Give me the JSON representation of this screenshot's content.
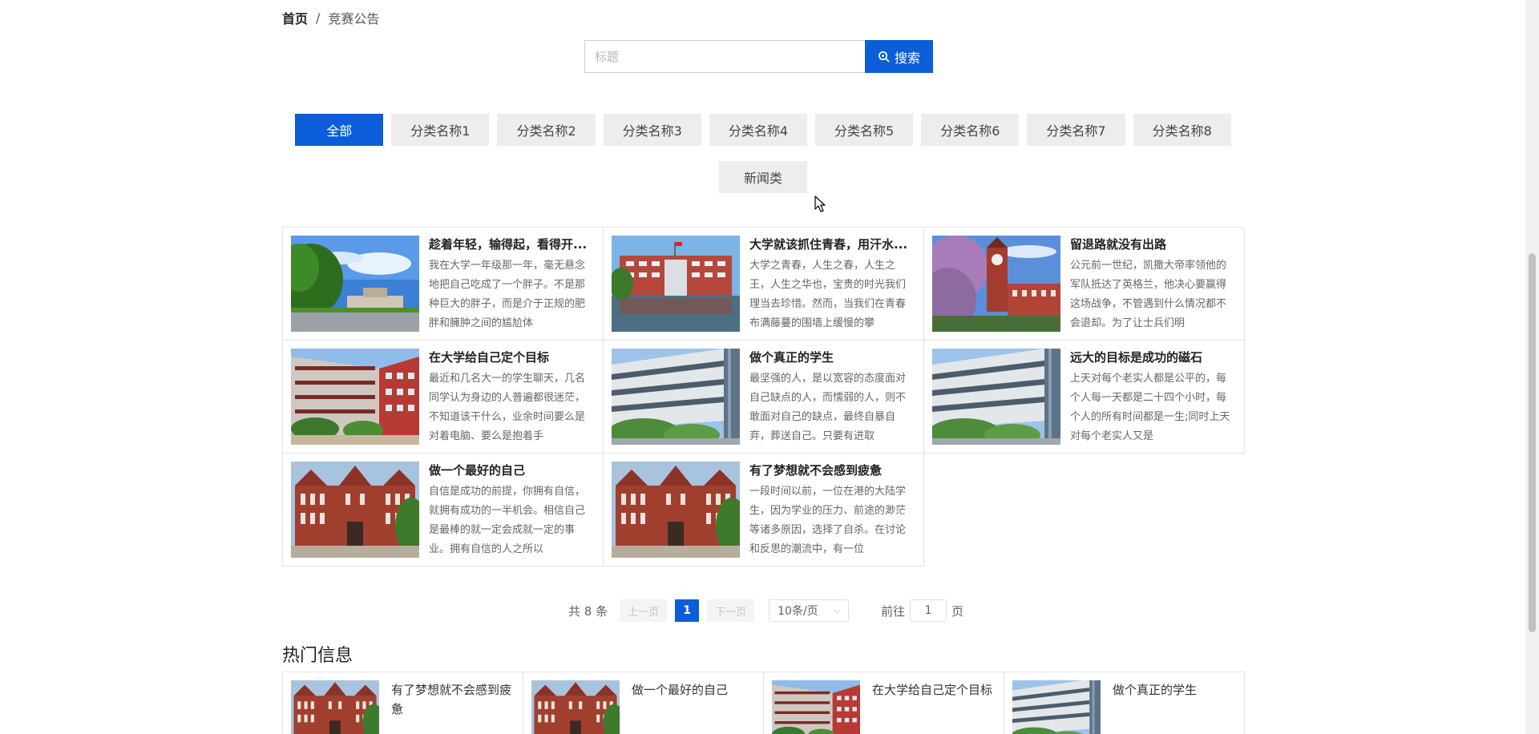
{
  "breadcrumb": {
    "home": "首页",
    "separator": "/",
    "current": "竞赛公告"
  },
  "search": {
    "placeholder": "标题",
    "button_label": "搜索"
  },
  "categories": [
    "全部",
    "分类名称1",
    "分类名称2",
    "分类名称3",
    "分类名称4",
    "分类名称5",
    "分类名称6",
    "分类名称7",
    "分类名称8",
    "新闻类"
  ],
  "active_category": "全部",
  "articles": [
    {
      "title": "趁着年轻，输得起，看得开...",
      "desc": "我在大学一年级那一年，毫无悬念地把自己吃成了一个胖子。不是那种巨大的胖子，而是介于正规的肥胖和臃肿之间的尴尬体",
      "image": "campus-sky"
    },
    {
      "title": "大学就该抓住青春，用汗水...",
      "desc": "大学之青春，人生之春，人生之王，人生之华也，宝贵的时光我们理当去珍惜。然而，当我们在青春布满藤蔓的围墙上缓慢的攀",
      "image": "campus-pool"
    },
    {
      "title": "留退路就没有出路",
      "desc": "公元前一世纪，凯撒大帝率领他的军队抵达了英格兰，他决心要赢得这场战争，不管遇到什么情况都不会退却。为了让士兵们明",
      "image": "clock-tower"
    },
    {
      "title": "在大学给自己定个目标",
      "desc": "最近和几名大一的学生聊天，几名同学认为身边的人普遍都很迷茫，不知道该干什么，业余时间要么是对着电脑、要么是抱着手",
      "image": "red-building"
    },
    {
      "title": "做个真正的学生",
      "desc": "最坚强的人，是以宽容的态度面对自己缺点的人，而懦弱的人，则不敢面对自己的缺点，最终自暴自弃，葬送自己。只要有进取",
      "image": "modern-building"
    },
    {
      "title": "远大的目标是成功的磁石",
      "desc": "上天对每个老实人都是公平的，每个人每一天都是二十四个小时，每个人的所有时间都是一生;同时上天对每个老实人又是",
      "image": "modern-building"
    },
    {
      "title": "做一个最好的自己",
      "desc": "自信是成功的前提，你拥有自信，就拥有成功的一半机会。相信自己是最棒的就一定会成就一定的事业。拥有自信的人之所以",
      "image": "brick-hall"
    },
    {
      "title": "有了梦想就不会感到疲惫",
      "desc": "一段时间以前，一位在港的大陆学生，因为学业的压力、前途的渺茫等诸多原因，选择了自杀。在讨论和反思的潮流中，有一位",
      "image": "brick-hall"
    }
  ],
  "pagination": {
    "total_label": "共 8 条",
    "prev_label": "上一页",
    "current_page": "1",
    "next_label": "下一页",
    "page_size_label": "10条/页",
    "goto_label": "前往",
    "goto_value": "1",
    "page_suffix": "页"
  },
  "hot": {
    "title": "热门信息",
    "items": [
      {
        "title": "有了梦想就不会感到疲惫",
        "image": "brick-hall"
      },
      {
        "title": "做一个最好的自己",
        "image": "brick-hall"
      },
      {
        "title": "在大学给自己定个目标",
        "image": "red-building"
      },
      {
        "title": "做个真正的学生",
        "image": "modern-building"
      }
    ]
  },
  "colors": {
    "accent": "#0b5ed7",
    "category_bg": "#ededed",
    "border": "#e3e3e3"
  }
}
